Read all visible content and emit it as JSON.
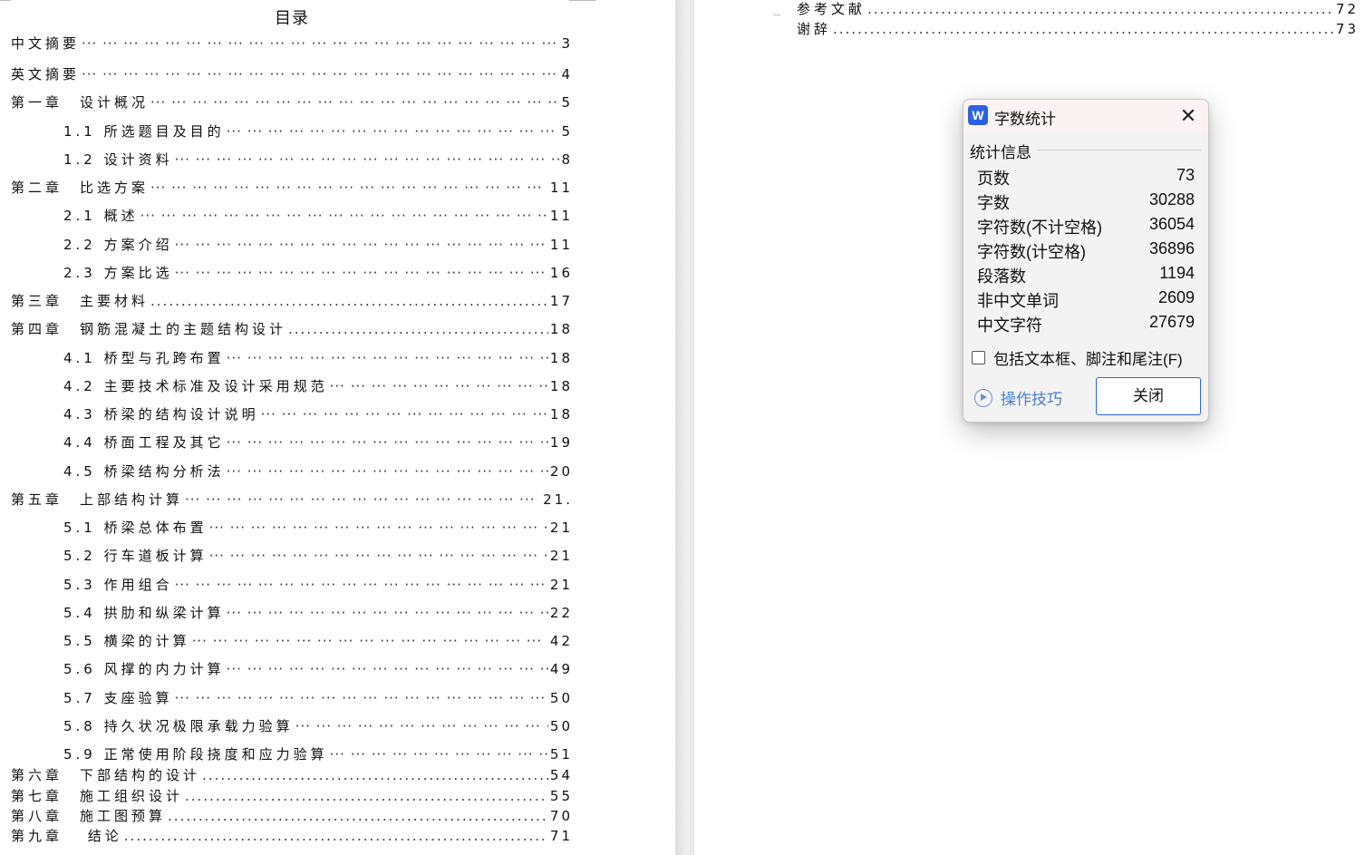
{
  "document": {
    "toc_title": "目录",
    "left_entries": [
      {
        "label": "中文摘要",
        "page": "3"
      },
      {
        "label": "英文摘要",
        "page": "4"
      },
      {
        "label": "第一章　设计概况",
        "page": "5"
      },
      {
        "label": "1.1 所选题目及目的",
        "page": "5"
      },
      {
        "label": "1.2 设计资料",
        "page": "8"
      },
      {
        "label": "第二章　比选方案",
        "page": "11"
      },
      {
        "label": "2.1 概述",
        "page": "11"
      },
      {
        "label": "2.2 方案介绍",
        "page": "11"
      },
      {
        "label": "2.3 方案比选",
        "page": "16"
      },
      {
        "label": "第三章　主要材料",
        "page": "17"
      },
      {
        "label": "第四章　钢筋混凝土的主题结构设计",
        "page": "18"
      },
      {
        "label": "4.1 桥型与孔跨布置",
        "page": "18"
      },
      {
        "label": "4.2 主要技术标准及设计采用规范",
        "page": "18"
      },
      {
        "label": "4.3 桥梁的结构设计说明",
        "page": "18"
      },
      {
        "label": "4.4 桥面工程及其它",
        "page": "19"
      },
      {
        "label": "4.5 桥梁结构分析法",
        "page": "20"
      },
      {
        "label": "第五章　上部结构计算",
        "page": "21."
      },
      {
        "label": "5.1 桥梁总体布置",
        "page": "21"
      },
      {
        "label": "5.2 行车道板计算",
        "page": "21"
      },
      {
        "label": "5.3 作用组合",
        "page": "21"
      },
      {
        "label": "5.4 拱肋和纵梁计算",
        "page": "22"
      },
      {
        "label": "5.5 横梁的计算",
        "page": "42"
      },
      {
        "label": "5.6 风撑的内力计算",
        "page": "49"
      },
      {
        "label": "5.7 支座验算",
        "page": "50"
      },
      {
        "label": "5.8 持久状况极限承载力验算",
        "page": "50"
      },
      {
        "label": "5.9 正常使用阶段挠度和应力验算",
        "page": "51"
      },
      {
        "label": "第六章　下部结构的设计",
        "page": "54"
      },
      {
        "label": "第七章　施工组织设计",
        "page": "55"
      },
      {
        "label": "第八章　施工图预算",
        "page": "70"
      },
      {
        "label": "第九章　 结论",
        "page": "71"
      }
    ],
    "right_entries": [
      {
        "label": "参考文献",
        "page": "72"
      },
      {
        "label": "谢辞",
        "page": "73"
      }
    ]
  },
  "dialog": {
    "app_icon": "W",
    "title": "字数统计",
    "group_title": "统计信息",
    "stats": [
      {
        "label": "页数",
        "value": "73"
      },
      {
        "label": "字数",
        "value": "30288"
      },
      {
        "label": "字符数(不计空格)",
        "value": "36054"
      },
      {
        "label": "字符数(计空格)",
        "value": "36896"
      },
      {
        "label": "段落数",
        "value": "1194"
      },
      {
        "label": "非中文单词",
        "value": "2609"
      },
      {
        "label": "中文字符",
        "value": "27679"
      }
    ],
    "checkbox_label": "包括文本框、脚注和尾注(F)",
    "checkbox_checked": false,
    "tips_label": "操作技巧",
    "close_button_label": "关闭",
    "accent_color": "#2b62e3"
  }
}
